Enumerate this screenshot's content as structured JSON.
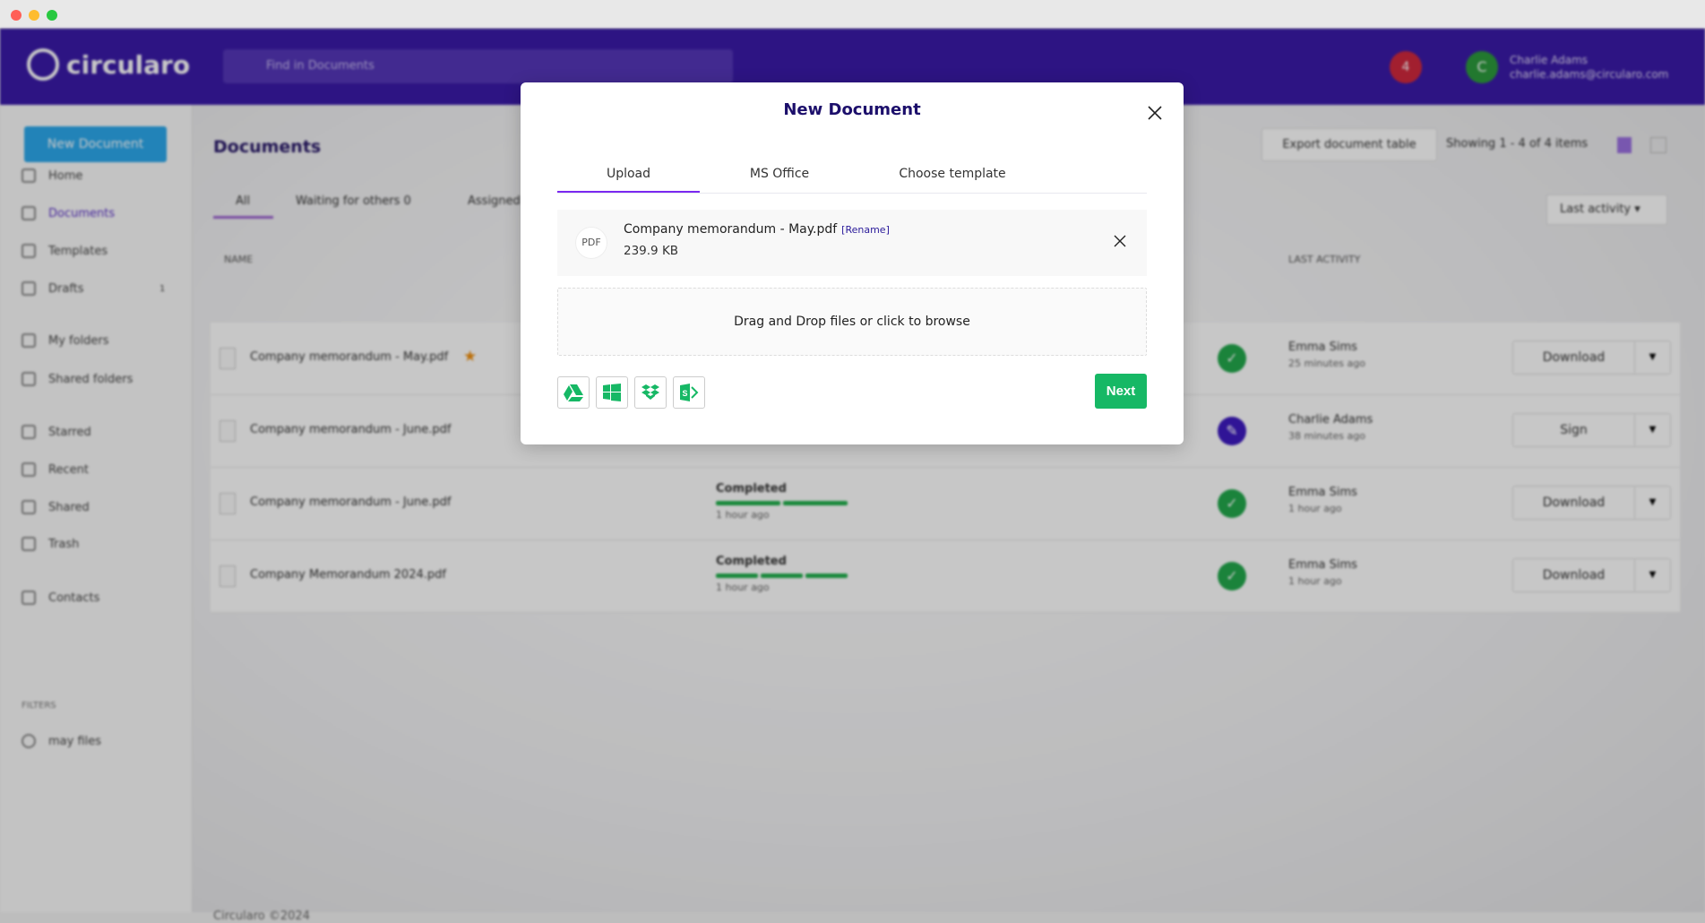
{
  "titlebar": {
    "dots": [
      "#ff5f57",
      "#febc2e",
      "#28c840"
    ]
  },
  "header": {
    "brand": "circularo",
    "search_placeholder": "Find in Documents",
    "notifications": "4",
    "user_initial": "C",
    "user_name": "Charlie Adams",
    "user_email": "charlie.adams@circularo.com"
  },
  "sidebar": {
    "new_document": "New Document",
    "items": [
      {
        "label": "Home",
        "icon": "home-icon"
      },
      {
        "label": "Documents",
        "icon": "document-icon",
        "active": true
      },
      {
        "label": "Templates",
        "icon": "template-icon"
      },
      {
        "label": "Drafts",
        "icon": "edit-icon",
        "badge": "1"
      },
      {
        "label": "My folders",
        "icon": "folder-icon"
      },
      {
        "label": "Shared folders",
        "icon": "shared-folder-icon"
      },
      {
        "label": "Starred",
        "icon": "star-icon"
      },
      {
        "label": "Recent",
        "icon": "clock-icon"
      },
      {
        "label": "Shared",
        "icon": "share-icon"
      },
      {
        "label": "Trash",
        "icon": "trash-icon"
      },
      {
        "label": "Contacts",
        "icon": "contacts-icon"
      }
    ],
    "filters_label": "FILTERS",
    "filter_item": "may files"
  },
  "main": {
    "title": "Documents",
    "export": "Export document table",
    "showing": "Showing 1 - 4 of 4 items",
    "tabs": [
      "All",
      "Waiting for others",
      "Assigned"
    ],
    "waiting_count": "0",
    "sort": "Last activity",
    "columns": {
      "name": "NAME",
      "last_activity": "LAST ACTIVITY"
    },
    "rows": [
      {
        "name": "Company memorandum - May.pdf",
        "starred": true,
        "status": "",
        "status_time": "",
        "state": "completed",
        "actor": "Emma Sims",
        "time": "25 minutes ago",
        "action": "Download"
      },
      {
        "name": "Company memorandum - June.pdf",
        "starred": false,
        "status": "",
        "status_time": "",
        "state": "sign",
        "actor": "Charlie Adams",
        "time": "38 minutes ago",
        "action": "Sign"
      },
      {
        "name": "Company memorandum - June.pdf",
        "starred": false,
        "status": "Completed",
        "status_time": "1 hour ago",
        "state": "completed",
        "actor": "Emma Sims",
        "time": "1 hour ago",
        "action": "Download"
      },
      {
        "name": "Company Memorandum 2024.pdf",
        "starred": false,
        "status": "Completed",
        "status_time": "1 hour ago",
        "state": "completed",
        "actor": "Emma Sims",
        "time": "1 hour ago",
        "action": "Download"
      }
    ],
    "footer": "Circularo ©2024"
  },
  "modal": {
    "title": "New Document",
    "tabs": [
      {
        "label": "Upload",
        "active": true
      },
      {
        "label": "MS Office"
      },
      {
        "label": "Choose template"
      }
    ],
    "file": {
      "type": "PDF",
      "name": "Company memorandum - May.pdf",
      "rename": "[Rename]",
      "size": "239.9 KB"
    },
    "dropzone": "Drag and Drop files or click to browse",
    "sources": [
      "google-drive-icon",
      "windows-onedrive-icon",
      "dropbox-icon",
      "sharepoint-icon"
    ],
    "next": "Next",
    "accent": "#16b865"
  }
}
